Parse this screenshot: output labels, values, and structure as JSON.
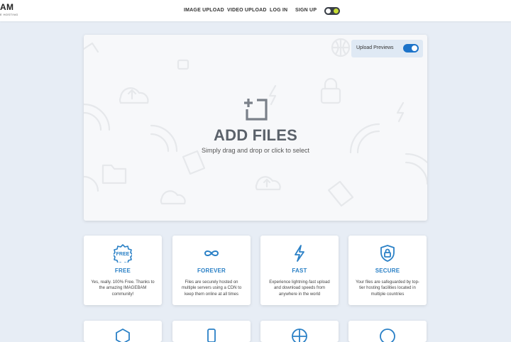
{
  "logo": {
    "main": "AM",
    "sub": "E HOSTING"
  },
  "nav": [
    {
      "label": "IMAGE UPLOAD"
    },
    {
      "label": "VIDEO UPLOAD"
    },
    {
      "label": "LOG IN"
    },
    {
      "label": "SIGN UP"
    }
  ],
  "upload": {
    "previews_label": "Upload Previews",
    "previews_enabled": true,
    "title": "ADD FILES",
    "subtitle": "Simply drag and drop or click to select"
  },
  "features": [
    {
      "icon": "free-badge-icon",
      "badge": "FREE",
      "title": "FREE",
      "desc": "Yes, really. 100% Free. Thanks to the amazing IMAGEBAM community!"
    },
    {
      "icon": "infinity-icon",
      "title": "FOREVER",
      "desc": "Files are securely hosted on multiple servers using a CDN to keep them online at all times"
    },
    {
      "icon": "lightning-icon",
      "title": "FAST",
      "desc": "Experience lightning-fast upload and download speeds from anywhere in the world"
    },
    {
      "icon": "shield-lock-icon",
      "title": "SECURE",
      "desc": "Your files are safeguarded by top-tier hosting facilities located in multiple countries"
    }
  ],
  "colors": {
    "accent": "#2a80c6",
    "toggle": "#1c73c9",
    "background": "#e7edf5"
  }
}
